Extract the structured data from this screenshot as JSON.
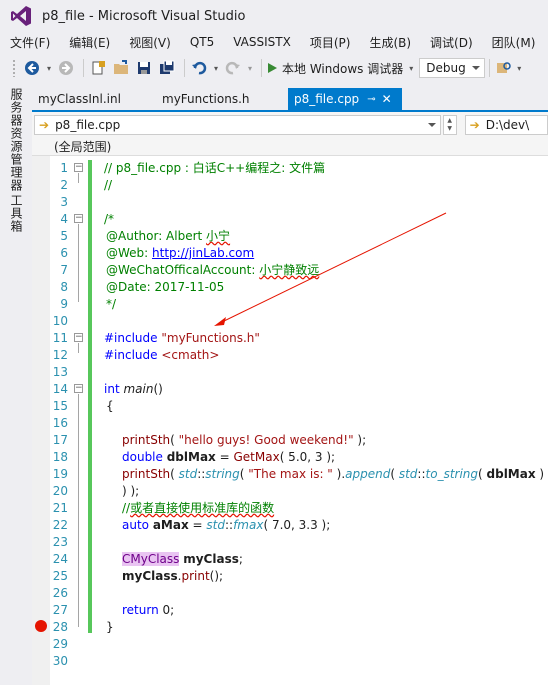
{
  "window": {
    "title": "p8_file - Microsoft Visual Studio"
  },
  "menu": [
    "文件(F)",
    "编辑(E)",
    "视图(V)",
    "QT5",
    "VASSISTX",
    "项目(P)",
    "生成(B)",
    "调试(D)",
    "团队(M)"
  ],
  "toolbar": {
    "run_label": "本地 Windows 调试器",
    "config": "Debug"
  },
  "side_tabs": [
    "服务器资源管理器",
    "工具箱"
  ],
  "doc_tabs": [
    {
      "label": "myClassInl.inl"
    },
    {
      "label": "myFunctions.h"
    },
    {
      "label": "p8_file.cpp",
      "active": true
    }
  ],
  "nav": {
    "file": "p8_file.cpp",
    "path": "D:\\dev\\",
    "scope": "(全局范围)"
  },
  "colors": {
    "accent": "#007acc",
    "change_bar": "#57c75b",
    "breakpoint": "#e51400"
  },
  "code": {
    "l1": "// p8_file.cpp : 白话C++编程之: 文件篇",
    "l2": "//",
    "l4": "/*",
    "l5a": "@Author: Albert ",
    "l5b": "小宁",
    "l6a": "@Web: ",
    "l6b": "http://jinLab.com",
    "l7a": "@WeChatOfficalAccount: ",
    "l7b": "小宁静致远",
    "l8": "@Date: 2017-11-05",
    "l9": "*/",
    "l11a": "#include ",
    "l11b": "\"myFunctions.h\"",
    "l12a": "#include ",
    "l12b": "<cmath>",
    "l14a": "int ",
    "l14b": "main",
    "l14c": "()",
    "l15": "{",
    "l17a": "printSth",
    "l17b": "( ",
    "l17c": "\"hello guys! Good weekend!\"",
    "l17d": " );",
    "l18a": "double ",
    "l18b": "dblMax",
    "l18c": " = ",
    "l18d": "GetMax",
    "l18e": "( 5.0, 3 );",
    "l19a": "printSth",
    "l19b": "( ",
    "l19c": "std",
    "l19d": "::",
    "l19e": "string",
    "l19f": "( ",
    "l19g": "\"The max is: \"",
    "l19h": " ).",
    "l19i": "append",
    "l19j": "( ",
    "l19k": "std",
    "l19l": "::",
    "l19m": "to_string",
    "l19n": "( ",
    "l19o": "dblMax",
    "l19p": " ) ) );",
    "l21a": "//",
    "l21b": "或者直接使用标准库的函数",
    "l22a": "auto ",
    "l22b": "aMax",
    "l22c": " = ",
    "l22d": "std",
    "l22e": "::",
    "l22f": "fmax",
    "l22g": "( 7.0, 3.3 );",
    "l24a": "CMyClass",
    "l24b": " ",
    "l24c": "myClass",
    "l24d": ";",
    "l25a": "myClass",
    "l25b": ".",
    "l25c": "print",
    "l25d": "();",
    "l27a": "return ",
    "l27b": "0;",
    "l28": "}"
  },
  "line_numbers": [
    "1",
    "2",
    "3",
    "4",
    "5",
    "6",
    "7",
    "8",
    "9",
    "10",
    "11",
    "12",
    "13",
    "14",
    "15",
    "16",
    "17",
    "18",
    "19",
    "20",
    "21",
    "22",
    "23",
    "24",
    "25",
    "26",
    "27",
    "28",
    "29",
    "30"
  ]
}
